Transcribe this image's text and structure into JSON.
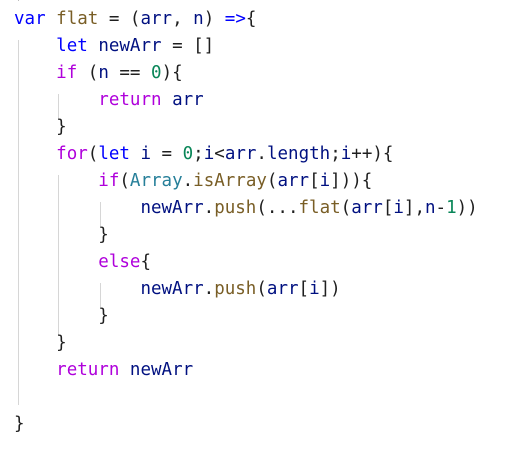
{
  "editor": {
    "lines": [
      {
        "tokens": [
          {
            "t": "var",
            "c": "kw"
          },
          {
            "t": " ",
            "c": "op"
          },
          {
            "t": "flat",
            "c": "fn"
          },
          {
            "t": " = (",
            "c": "op"
          },
          {
            "t": "arr",
            "c": "var"
          },
          {
            "t": ", ",
            "c": "op"
          },
          {
            "t": "n",
            "c": "var"
          },
          {
            "t": ") ",
            "c": "op"
          },
          {
            "t": "=>",
            "c": "kw"
          },
          {
            "t": "{",
            "c": "op"
          }
        ]
      },
      {
        "tokens": [
          {
            "t": "    ",
            "c": "op"
          },
          {
            "t": "let",
            "c": "kw"
          },
          {
            "t": " ",
            "c": "op"
          },
          {
            "t": "newArr",
            "c": "var"
          },
          {
            "t": " = []",
            "c": "op"
          }
        ]
      },
      {
        "tokens": [
          {
            "t": "    ",
            "c": "op"
          },
          {
            "t": "if",
            "c": "ctl"
          },
          {
            "t": " (",
            "c": "op"
          },
          {
            "t": "n",
            "c": "var"
          },
          {
            "t": " == ",
            "c": "op"
          },
          {
            "t": "0",
            "c": "num"
          },
          {
            "t": "){",
            "c": "op"
          }
        ]
      },
      {
        "tokens": [
          {
            "t": "        ",
            "c": "op"
          },
          {
            "t": "return",
            "c": "ctl"
          },
          {
            "t": " ",
            "c": "op"
          },
          {
            "t": "arr",
            "c": "var"
          }
        ]
      },
      {
        "tokens": [
          {
            "t": "    }",
            "c": "op"
          }
        ]
      },
      {
        "tokens": [
          {
            "t": "    ",
            "c": "op"
          },
          {
            "t": "for",
            "c": "ctl"
          },
          {
            "t": "(",
            "c": "op"
          },
          {
            "t": "let",
            "c": "kw"
          },
          {
            "t": " ",
            "c": "op"
          },
          {
            "t": "i",
            "c": "var"
          },
          {
            "t": " = ",
            "c": "op"
          },
          {
            "t": "0",
            "c": "num"
          },
          {
            "t": ";",
            "c": "op"
          },
          {
            "t": "i",
            "c": "var"
          },
          {
            "t": "<",
            "c": "op"
          },
          {
            "t": "arr",
            "c": "var"
          },
          {
            "t": ".",
            "c": "op"
          },
          {
            "t": "length",
            "c": "var"
          },
          {
            "t": ";",
            "c": "op"
          },
          {
            "t": "i",
            "c": "var"
          },
          {
            "t": "++){",
            "c": "op"
          }
        ]
      },
      {
        "tokens": [
          {
            "t": "        ",
            "c": "op"
          },
          {
            "t": "if",
            "c": "ctl"
          },
          {
            "t": "(",
            "c": "op"
          },
          {
            "t": "Array",
            "c": "type"
          },
          {
            "t": ".",
            "c": "op"
          },
          {
            "t": "isArray",
            "c": "fn"
          },
          {
            "t": "(",
            "c": "op"
          },
          {
            "t": "arr",
            "c": "var"
          },
          {
            "t": "[",
            "c": "op"
          },
          {
            "t": "i",
            "c": "var"
          },
          {
            "t": "])){",
            "c": "op"
          }
        ]
      },
      {
        "tokens": [
          {
            "t": "            ",
            "c": "op"
          },
          {
            "t": "newArr",
            "c": "var"
          },
          {
            "t": ".",
            "c": "op"
          },
          {
            "t": "push",
            "c": "fn"
          },
          {
            "t": "(...",
            "c": "op"
          },
          {
            "t": "flat",
            "c": "fn"
          },
          {
            "t": "(",
            "c": "op"
          },
          {
            "t": "arr",
            "c": "var"
          },
          {
            "t": "[",
            "c": "op"
          },
          {
            "t": "i",
            "c": "var"
          },
          {
            "t": "],",
            "c": "op"
          },
          {
            "t": "n",
            "c": "var"
          },
          {
            "t": "-",
            "c": "op"
          },
          {
            "t": "1",
            "c": "num"
          },
          {
            "t": "))",
            "c": "op"
          }
        ]
      },
      {
        "tokens": [
          {
            "t": "        }",
            "c": "op"
          }
        ]
      },
      {
        "tokens": [
          {
            "t": "        ",
            "c": "op"
          },
          {
            "t": "else",
            "c": "ctl"
          },
          {
            "t": "{",
            "c": "op"
          }
        ]
      },
      {
        "tokens": [
          {
            "t": "            ",
            "c": "op"
          },
          {
            "t": "newArr",
            "c": "var"
          },
          {
            "t": ".",
            "c": "op"
          },
          {
            "t": "push",
            "c": "fn"
          },
          {
            "t": "(",
            "c": "op"
          },
          {
            "t": "arr",
            "c": "var"
          },
          {
            "t": "[",
            "c": "op"
          },
          {
            "t": "i",
            "c": "var"
          },
          {
            "t": "])",
            "c": "op"
          }
        ]
      },
      {
        "tokens": [
          {
            "t": "        }",
            "c": "op"
          }
        ]
      },
      {
        "tokens": [
          {
            "t": "    }",
            "c": "op"
          }
        ]
      },
      {
        "tokens": [
          {
            "t": "    ",
            "c": "op"
          },
          {
            "t": "return",
            "c": "ctl"
          },
          {
            "t": " ",
            "c": "op"
          },
          {
            "t": "newArr",
            "c": "var"
          }
        ]
      },
      {
        "tokens": []
      },
      {
        "tokens": [
          {
            "t": "}",
            "c": "op"
          }
        ]
      }
    ]
  }
}
